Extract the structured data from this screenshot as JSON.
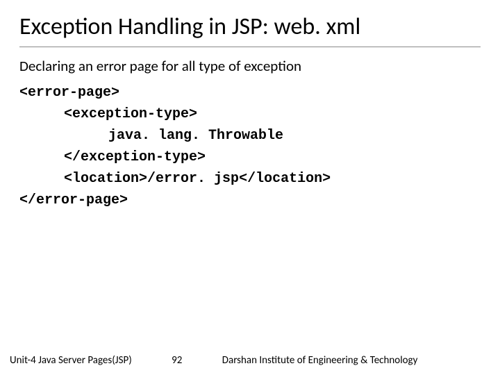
{
  "title": "Exception Handling in JSP: web. xml",
  "subtitle": "Declaring an error page for all type of exception",
  "code": {
    "l1": "<error-page>",
    "l2": "<exception-type>",
    "l3": "java. lang. Throwable",
    "l4": "</exception-type>",
    "l5a": "<location>",
    "l5b": "/error. jsp",
    "l5c": "</location>",
    "l6": "</error-page>"
  },
  "footer": {
    "left": "Unit-4 Java Server Pages(JSP)",
    "page": "92",
    "right": "Darshan Institute of Engineering & Technology"
  }
}
